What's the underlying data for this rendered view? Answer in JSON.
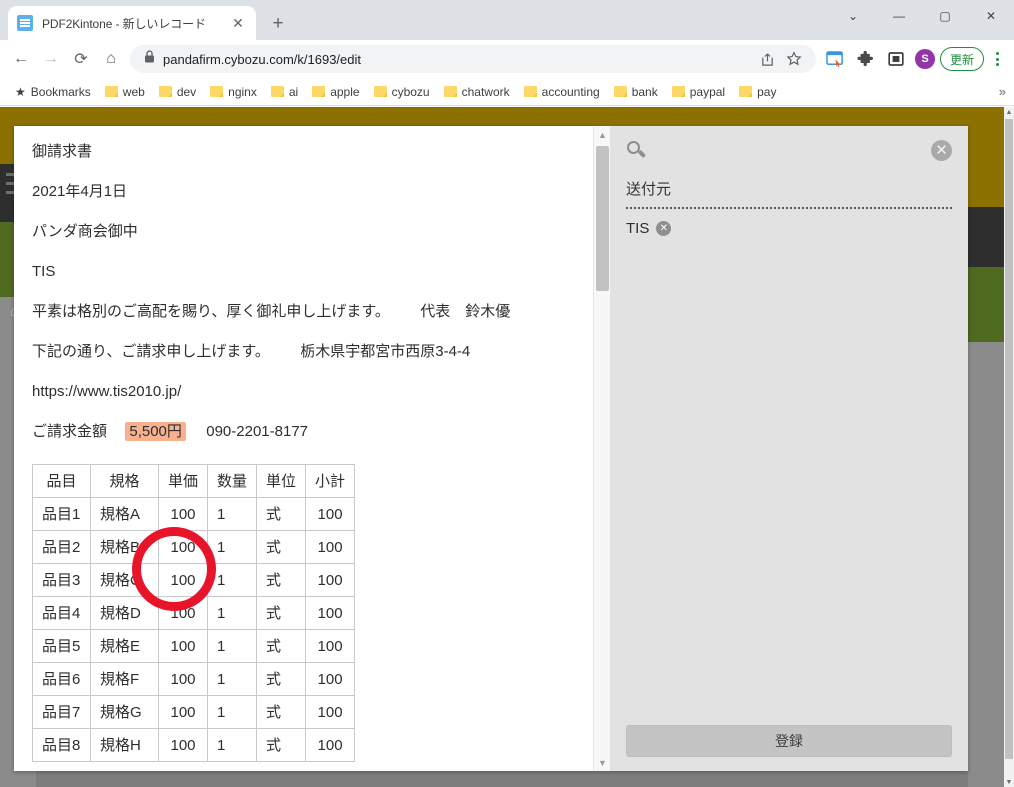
{
  "browser": {
    "tab": {
      "title": "PDF2Kintone - 新しいレコード",
      "favicon": "kintone-app-icon",
      "close_label": "✕"
    },
    "newtab_label": "+",
    "window_controls": {
      "tab_search": "⌄",
      "minimize": "—",
      "maximize": "▢",
      "close": "✕"
    },
    "nav": {
      "back": "←",
      "forward": "→",
      "reload": "⟳",
      "home": "⌂"
    },
    "omnibox": {
      "lock_icon": "🔒",
      "url": "pandafirm.cybozu.com/k/1693/edit",
      "share_icon": "share-icon",
      "bookmark_icon": "☆"
    },
    "extensions": [
      {
        "name": "clipper-extension-icon"
      },
      {
        "name": "puzzle-extensions-icon"
      },
      {
        "name": "sidepanel-icon"
      }
    ],
    "profile_initial": "S",
    "update_button": "更新",
    "menu_label": "⋮",
    "bookmarks": {
      "star_label": "Bookmarks",
      "items": [
        "web",
        "dev",
        "nginx",
        "ai",
        "apple",
        "cybozu",
        "chatwork",
        "accounting",
        "bank",
        "paypal",
        "pay"
      ],
      "overflow": "»"
    }
  },
  "document": {
    "title": "御請求書",
    "date": "2021年4月1日",
    "addressee": "パンダ商会御中",
    "company": "TIS",
    "greeting": "平素は格別のご高配を賜り、厚く御礼申し上げます。",
    "greeting_right": "代表　鈴木優",
    "request_line": "下記の通り、ご請求申し上げます。",
    "request_right": "栃木県宇都宮市西原3-4-4",
    "url": "https://www.tis2010.jp/",
    "amount_label": "ご請求金額",
    "amount_value": "5,500円",
    "phone": "090-2201-8177",
    "table": {
      "headers": [
        "品目",
        "規格",
        "単価",
        "数量",
        "単位",
        "小計"
      ],
      "rows": [
        [
          "品目1",
          "規格A",
          "100",
          "1",
          "式",
          "100"
        ],
        [
          "品目2",
          "規格B",
          "100",
          "1",
          "式",
          "100"
        ],
        [
          "品目3",
          "規格C",
          "100",
          "1",
          "式",
          "100"
        ],
        [
          "品目4",
          "規格D",
          "100",
          "1",
          "式",
          "100"
        ],
        [
          "品目5",
          "規格E",
          "100",
          "1",
          "式",
          "100"
        ],
        [
          "品目6",
          "規格F",
          "100",
          "1",
          "式",
          "100"
        ],
        [
          "品目7",
          "規格G",
          "100",
          "1",
          "式",
          "100"
        ],
        [
          "品目8",
          "規格H",
          "100",
          "1",
          "式",
          "100"
        ]
      ]
    },
    "highlight_color": "#f8b18e",
    "annotation_color": "#e8152a"
  },
  "form": {
    "search_icon": "magnifier-icon",
    "close_label": "✕",
    "field_label": "送付元",
    "chip_value": "TIS",
    "chip_remove": "✕",
    "submit_label": "登録"
  },
  "scrollbars": {
    "doc_up": "▲",
    "doc_down": "▼",
    "page_up": "▲",
    "page_down": "▼"
  }
}
